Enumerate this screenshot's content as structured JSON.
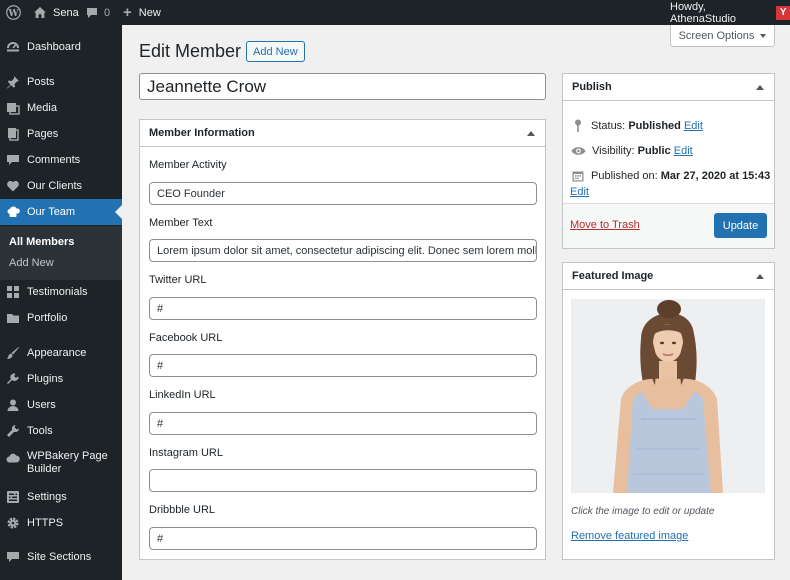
{
  "admin_bar": {
    "site_name": "Sena",
    "comments_count": "0",
    "new_label": "New",
    "howdy": "Howdy, AthenaStudio",
    "avatar_letter": "Y"
  },
  "sidebar": {
    "items": [
      {
        "label": "Dashboard",
        "icon": "dashboard-icon"
      },
      {
        "label": "Posts",
        "icon": "pin-icon"
      },
      {
        "label": "Media",
        "icon": "media-icon"
      },
      {
        "label": "Pages",
        "icon": "pages-icon"
      },
      {
        "label": "Comments",
        "icon": "comment-icon"
      },
      {
        "label": "Our Clients",
        "icon": "heart-icon"
      },
      {
        "label": "Our Team",
        "icon": "team-icon"
      },
      {
        "label": "Testimonials",
        "icon": "grid-icon"
      },
      {
        "label": "Portfolio",
        "icon": "folder-icon"
      },
      {
        "label": "Appearance",
        "icon": "brush-icon"
      },
      {
        "label": "Plugins",
        "icon": "plug-icon"
      },
      {
        "label": "Users",
        "icon": "user-icon"
      },
      {
        "label": "Tools",
        "icon": "wrench-icon"
      },
      {
        "label": "WPBakery Page Builder",
        "icon": "cloud-icon"
      },
      {
        "label": "Settings",
        "icon": "settings-icon"
      },
      {
        "label": "HTTPS",
        "icon": "gear-icon"
      },
      {
        "label": "Site Sections",
        "icon": "comment-icon"
      }
    ],
    "wpbakery_line1": "WPBakery Page",
    "wpbakery_line2": "Builder",
    "submenu": {
      "all_members": "All Members",
      "add_new": "Add New"
    }
  },
  "header": {
    "title": "Edit Member",
    "add_new": "Add New",
    "screen_options": "Screen Options"
  },
  "post_title": "Jeannette Crow",
  "member_info": {
    "heading": "Member Information",
    "fields": [
      {
        "label": "Member Activity",
        "value": "CEO Founder"
      },
      {
        "label": "Member Text",
        "value": "Lorem ipsum dolor sit amet, consectetur adipiscing elit. Donec sem lorem mollis."
      },
      {
        "label": "Twitter URL",
        "value": "#"
      },
      {
        "label": "Facebook URL",
        "value": "#"
      },
      {
        "label": "LinkedIn URL",
        "value": "#"
      },
      {
        "label": "Instagram URL",
        "value": ""
      },
      {
        "label": "Dribbble URL",
        "value": "#"
      }
    ]
  },
  "publish": {
    "heading": "Publish",
    "status_label": "Status:",
    "status_value": "Published",
    "visibility_label": "Visibility:",
    "visibility_value": "Public",
    "published_label": "Published on:",
    "published_value": "Mar 27, 2020 at 15:43",
    "edit": "Edit",
    "trash": "Move to Trash",
    "update": "Update"
  },
  "featured": {
    "heading": "Featured Image",
    "caption": "Click the image to edit or update",
    "remove": "Remove featured image"
  },
  "colors": {
    "accent": "#2271b1",
    "admin_dark": "#1d2327",
    "trash": "#b32d2e"
  }
}
